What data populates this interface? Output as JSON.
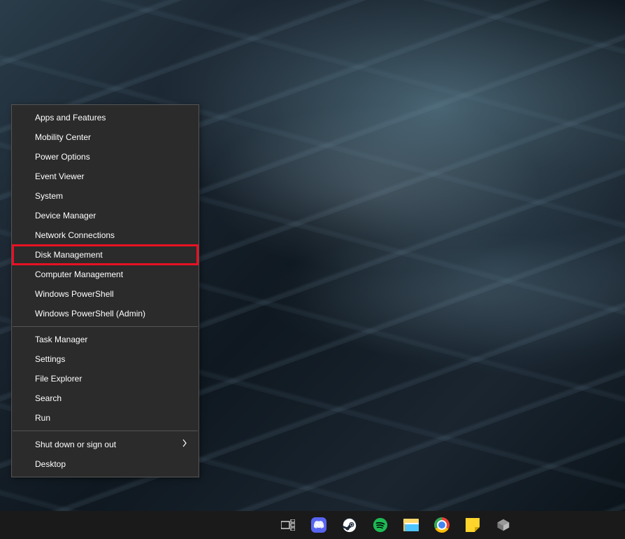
{
  "context_menu": {
    "groups": [
      {
        "items": [
          {
            "label": "Apps and Features",
            "highlighted": false,
            "has_submenu": false
          },
          {
            "label": "Mobility Center",
            "highlighted": false,
            "has_submenu": false
          },
          {
            "label": "Power Options",
            "highlighted": false,
            "has_submenu": false
          },
          {
            "label": "Event Viewer",
            "highlighted": false,
            "has_submenu": false
          },
          {
            "label": "System",
            "highlighted": false,
            "has_submenu": false
          },
          {
            "label": "Device Manager",
            "highlighted": false,
            "has_submenu": false
          },
          {
            "label": "Network Connections",
            "highlighted": false,
            "has_submenu": false
          },
          {
            "label": "Disk Management",
            "highlighted": true,
            "has_submenu": false
          },
          {
            "label": "Computer Management",
            "highlighted": false,
            "has_submenu": false
          },
          {
            "label": "Windows PowerShell",
            "highlighted": false,
            "has_submenu": false
          },
          {
            "label": "Windows PowerShell (Admin)",
            "highlighted": false,
            "has_submenu": false
          }
        ]
      },
      {
        "items": [
          {
            "label": "Task Manager",
            "highlighted": false,
            "has_submenu": false
          },
          {
            "label": "Settings",
            "highlighted": false,
            "has_submenu": false
          },
          {
            "label": "File Explorer",
            "highlighted": false,
            "has_submenu": false
          },
          {
            "label": "Search",
            "highlighted": false,
            "has_submenu": false
          },
          {
            "label": "Run",
            "highlighted": false,
            "has_submenu": false
          }
        ]
      },
      {
        "items": [
          {
            "label": "Shut down or sign out",
            "highlighted": false,
            "has_submenu": true
          },
          {
            "label": "Desktop",
            "highlighted": false,
            "has_submenu": false
          }
        ]
      }
    ]
  },
  "taskbar": {
    "icons": [
      {
        "name": "task-view",
        "label": "Task View"
      },
      {
        "name": "discord",
        "label": "Discord"
      },
      {
        "name": "steam",
        "label": "Steam"
      },
      {
        "name": "spotify",
        "label": "Spotify"
      },
      {
        "name": "file-explorer",
        "label": "File Explorer"
      },
      {
        "name": "chrome",
        "label": "Google Chrome"
      },
      {
        "name": "sticky-notes",
        "label": "Sticky Notes"
      },
      {
        "name": "sandbox",
        "label": "Windows Sandbox"
      }
    ]
  }
}
